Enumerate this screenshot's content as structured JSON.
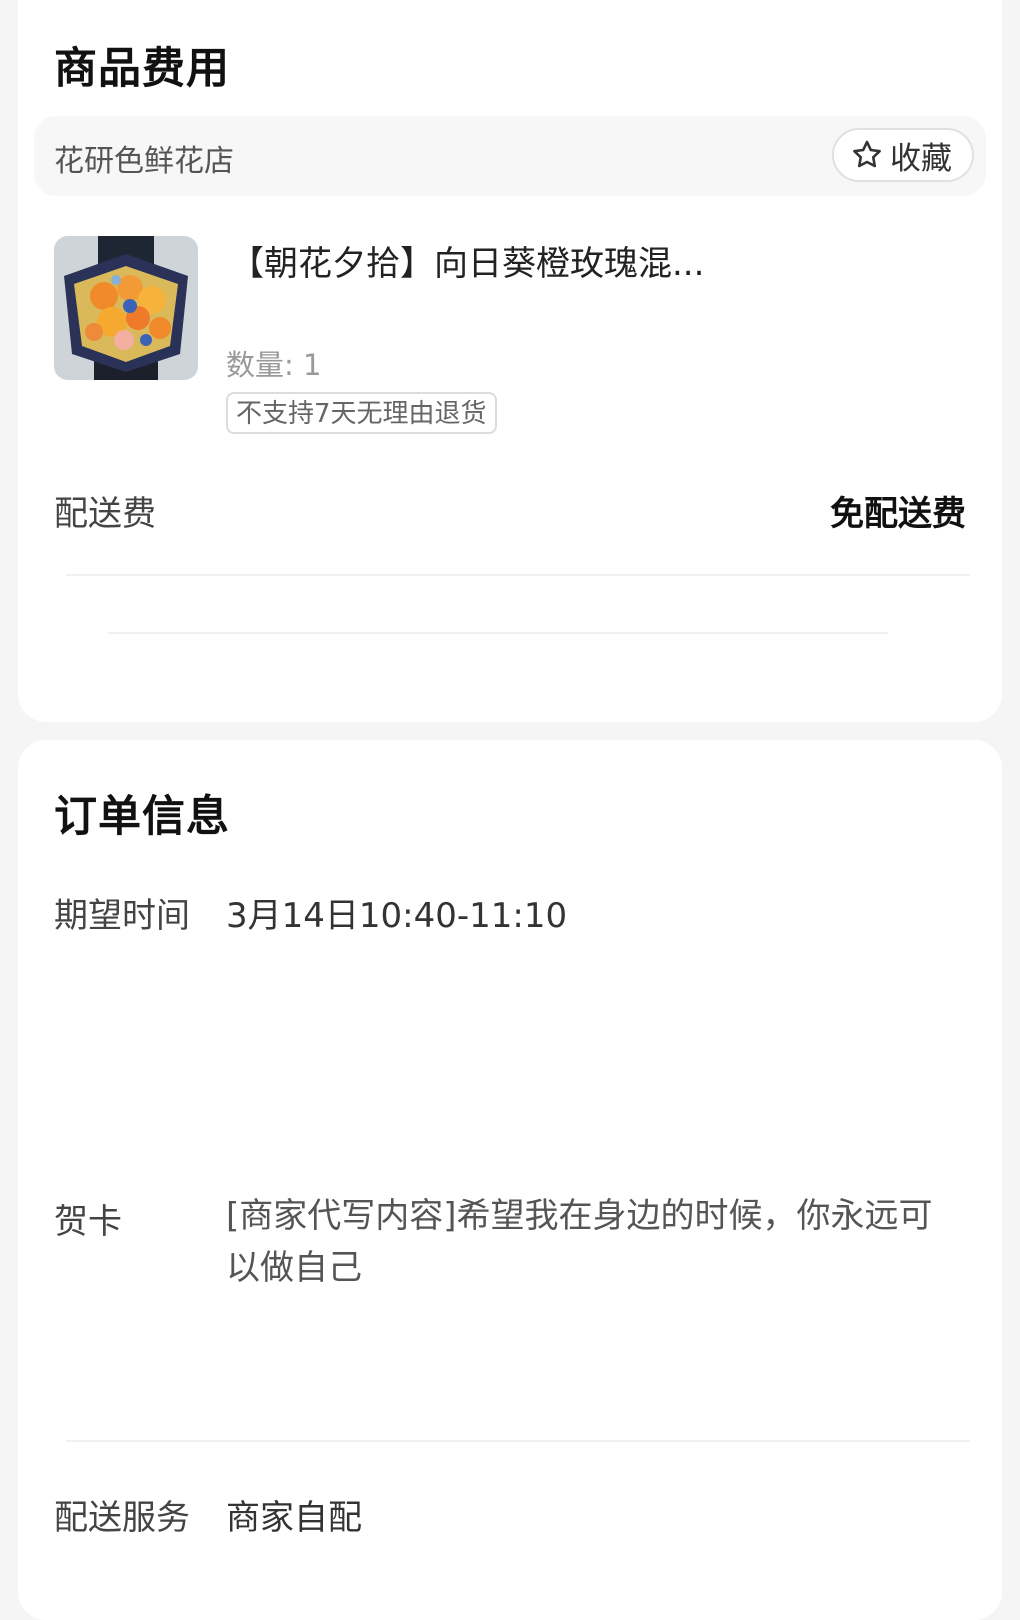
{
  "goods_section": {
    "title": "商品费用",
    "store": {
      "name": "花研色鲜花店",
      "favorite_label": "收藏",
      "favorite_icon": "star-outline-icon"
    },
    "product": {
      "title": "【朝花夕拾】向日葵橙玫瑰混...",
      "quantity": "数量: 1",
      "return_tag": "不支持7天无理由退货",
      "image_colors": [
        "#f08a2a",
        "#f6b23a",
        "#3a63b8",
        "#1f2a44"
      ]
    },
    "delivery_fee": {
      "label": "配送费",
      "value": "免配送费"
    }
  },
  "order_section": {
    "title": "订单信息",
    "expected_time": {
      "label": "期望时间",
      "value": "3月14日10:40-11:10"
    },
    "greeting_card": {
      "label": "贺卡",
      "value": "[商家代写内容]希望我在身边的时候，你永远可以做自己"
    },
    "delivery_service": {
      "label": "配送服务",
      "value": "商家自配"
    }
  }
}
